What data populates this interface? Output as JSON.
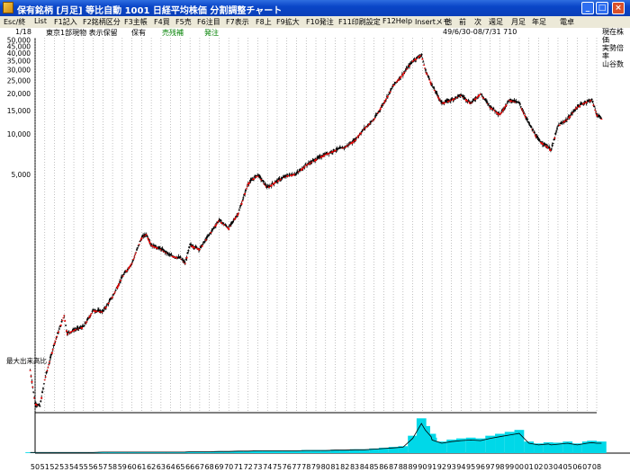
{
  "window": {
    "title": "保有銘柄 [月足] 等比自動  1001  日経平均株価 分割調整チャート",
    "min_label": "_",
    "max_label": "□",
    "close_label": "×"
  },
  "menu": [
    "Esc/終",
    "List",
    "F1記入",
    "F2銘柄区分",
    "F3主帳",
    "F4買",
    "F5売",
    "F6注目",
    "F7表示",
    "F8上",
    "F9拡大",
    "F10発注",
    "F11印刷設定",
    "F12Help",
    "Insertメモ",
    "他",
    "前",
    "次",
    "週足",
    "月足",
    "年足",
    "電卓"
  ],
  "info": {
    "page": "1/18",
    "market": "東京1部現物 表示保留",
    "hold": "保有",
    "sell_order": "売残補",
    "order": "発注",
    "range": "49/6/30-08/7/31 710"
  },
  "side_panel": [
    "現在株価",
    "実勢倍率",
    "山谷数"
  ],
  "volume_label": "最大出来高比",
  "chart_data": {
    "type": "candlestick",
    "ylabel_ticks": [
      "50,000",
      "45,000",
      "40,000",
      "35,000",
      "30,000",
      "25,000",
      "20,000",
      "15,000",
      "10,000",
      "5,000"
    ],
    "y_scale": "log",
    "ylim": [
      85,
      52000
    ],
    "x_ticks": [
      "50",
      "51",
      "52",
      "53",
      "54",
      "55",
      "56",
      "57",
      "58",
      "59",
      "60",
      "61",
      "62",
      "63",
      "64",
      "65",
      "66",
      "67",
      "68",
      "69",
      "70",
      "71",
      "72",
      "73",
      "74",
      "75",
      "76",
      "77",
      "78",
      "79",
      "80",
      "81",
      "82",
      "83",
      "84",
      "85",
      "86",
      "87",
      "88",
      "89",
      "90",
      "91",
      "92",
      "93",
      "94",
      "95",
      "96",
      "97",
      "98",
      "99",
      "00",
      "01",
      "02",
      "03",
      "04",
      "05",
      "06",
      "07",
      "08"
    ],
    "series": [
      {
        "x": [
          1949.5,
          1950,
          1950.5,
          1951,
          1952,
          1953,
          1953.3,
          1954,
          1955,
          1956,
          1957,
          1958,
          1959,
          1960,
          1961,
          1961.5,
          1962,
          1963,
          1964,
          1965,
          1965.5,
          1966,
          1967,
          1968,
          1969,
          1970,
          1971,
          1972,
          1973,
          1974,
          1975,
          1976,
          1977,
          1978,
          1979,
          1980,
          1981,
          1982,
          1983,
          1984,
          1985,
          1986,
          1987,
          1988,
          1989,
          1989.9,
          1990.3,
          1990.9,
          1991,
          1992,
          1993,
          1994,
          1995,
          1996,
          1997,
          1998,
          1999,
          2000,
          2001,
          2002,
          2003,
          2003.3,
          2004,
          2005,
          2006,
          2007,
          2007.5,
          2008,
          2008.5
        ],
        "values": [
          176,
          100,
          95,
          150,
          280,
          450,
          330,
          350,
          370,
          490,
          480,
          620,
          870,
          1100,
          1700,
          1800,
          1500,
          1400,
          1250,
          1200,
          1100,
          1500,
          1400,
          1800,
          2300,
          2000,
          2600,
          4300,
          5000,
          4000,
          4500,
          4900,
          5100,
          5900,
          6500,
          7100,
          7600,
          8000,
          9000,
          11000,
          12900,
          17000,
          23000,
          28000,
          35000,
          38900,
          30000,
          24000,
          23000,
          17000,
          18000,
          19500,
          17000,
          20000,
          16000,
          14000,
          18000,
          17000,
          12000,
          9000,
          8000,
          7600,
          11500,
          13000,
          16000,
          17500,
          18000,
          14000,
          13000
        ]
      }
    ],
    "volume_levels": [
      0.02,
      0.02,
      0.02,
      0.02,
      0.02,
      0.02,
      0.02,
      0.02,
      0.02,
      0.02,
      0.03,
      0.03,
      0.03,
      0.03,
      0.03,
      0.03,
      0.03,
      0.03,
      0.03,
      0.03,
      0.03,
      0.04,
      0.04,
      0.04,
      0.05,
      0.05,
      0.06,
      0.06,
      0.07,
      0.07,
      0.07,
      0.07,
      0.07,
      0.08,
      0.08,
      0.08,
      0.09,
      0.09,
      0.1,
      0.1,
      0.12,
      0.14,
      0.16,
      0.18,
      0.45,
      0.9,
      0.7,
      0.5,
      0.4,
      0.3,
      0.35,
      0.38,
      0.4,
      0.38,
      0.45,
      0.5,
      0.55,
      0.6,
      0.3,
      0.25,
      0.28,
      0.25,
      0.27,
      0.3,
      0.25,
      0.3,
      0.32,
      0.3,
      0.3
    ]
  }
}
